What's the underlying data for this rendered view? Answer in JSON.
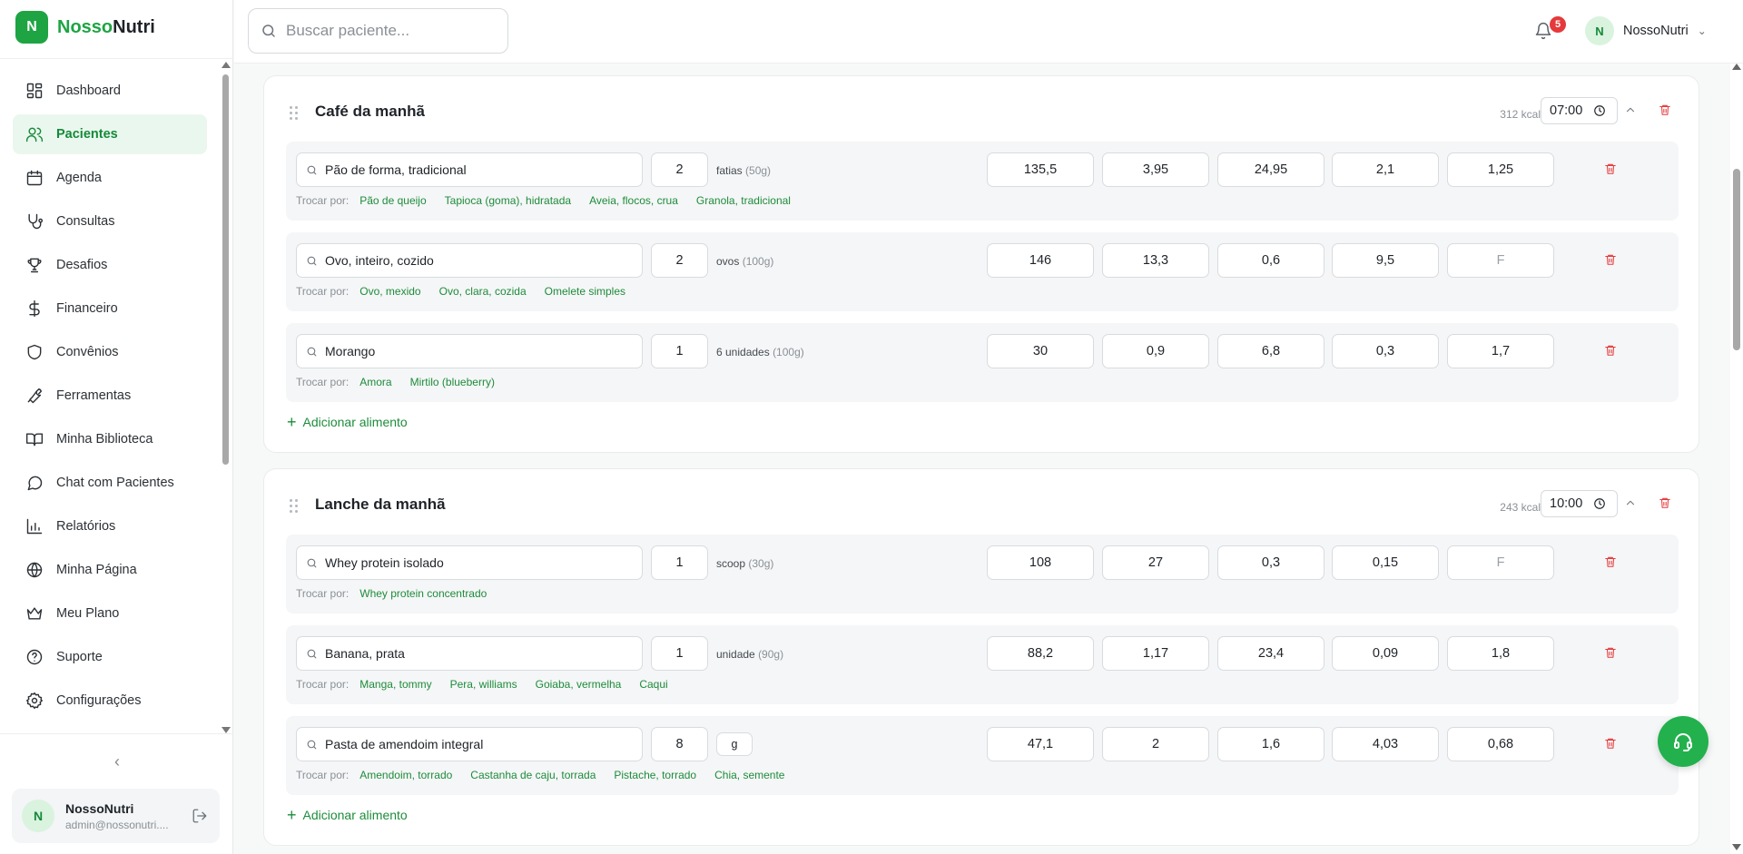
{
  "brand": {
    "logo_letter": "N",
    "name_part1": "Nosso",
    "name_part2": "Nutri",
    "color": "#1ea443"
  },
  "sidebar": {
    "items": [
      {
        "label": "Dashboard",
        "icon": "layout-grid-icon",
        "active": false
      },
      {
        "label": "Pacientes",
        "icon": "users-icon",
        "active": true
      },
      {
        "label": "Agenda",
        "icon": "calendar-icon",
        "active": false
      },
      {
        "label": "Consultas",
        "icon": "stethoscope-icon",
        "active": false
      },
      {
        "label": "Desafios",
        "icon": "trophy-icon",
        "active": false
      },
      {
        "label": "Financeiro",
        "icon": "dollar-icon",
        "active": false
      },
      {
        "label": "Convênios",
        "icon": "shield-icon",
        "active": false
      },
      {
        "label": "Ferramentas",
        "icon": "wrench-icon",
        "active": false
      },
      {
        "label": "Minha Biblioteca",
        "icon": "book-icon",
        "active": false
      },
      {
        "label": "Chat com Pacientes",
        "icon": "chat-icon",
        "active": false
      },
      {
        "label": "Relatórios",
        "icon": "bar-chart-icon",
        "active": false
      },
      {
        "label": "Minha Página",
        "icon": "globe-icon",
        "active": false
      },
      {
        "label": "Meu Plano",
        "icon": "crown-icon",
        "active": false
      },
      {
        "label": "Suporte",
        "icon": "help-circle-icon",
        "active": false
      },
      {
        "label": "Configurações",
        "icon": "settings-icon",
        "active": false
      }
    ],
    "user": {
      "initial": "N",
      "name": "NossoNutri",
      "email": "admin@nossonutri...."
    }
  },
  "header": {
    "search_placeholder": "Buscar paciente...",
    "notification_count": "5",
    "user_initial": "N",
    "user_name": "NossoNutri"
  },
  "meals": [
    {
      "title": "Café da manhã",
      "kcal": "312 kcal",
      "time": "07:00",
      "items": [
        {
          "food": "Pão de forma, tradicional",
          "qty": "2",
          "unit": "fatias",
          "unit_grams": "(50g)",
          "nutrients": [
            "135,5",
            "3,95",
            "24,95",
            "2,1",
            "1,25"
          ],
          "swaps_label": "Trocar por:",
          "swaps": [
            "Pão de queijo",
            "Tapioca (goma), hidratada",
            "Aveia, flocos, crua",
            "Granola, tradicional"
          ]
        },
        {
          "food": "Ovo, inteiro, cozido",
          "qty": "2",
          "unit": "ovos",
          "unit_grams": "(100g)",
          "nutrients": [
            "146",
            "13,3",
            "0,6",
            "9,5",
            "F"
          ],
          "swaps_label": "Trocar por:",
          "swaps": [
            "Ovo, mexido",
            "Ovo, clara, cozida",
            "Omelete simples"
          ]
        },
        {
          "food": "Morango",
          "qty": "1",
          "unit": "6 unidades",
          "unit_grams": "(100g)",
          "nutrients": [
            "30",
            "0,9",
            "6,8",
            "0,3",
            "1,7"
          ],
          "swaps_label": "Trocar por:",
          "swaps": [
            "Amora",
            "Mirtilo (blueberry)"
          ]
        }
      ],
      "add_label": "Adicionar alimento"
    },
    {
      "title": "Lanche da manhã",
      "kcal": "243 kcal",
      "time": "10:00",
      "items": [
        {
          "food": "Whey protein isolado",
          "qty": "1",
          "unit": "scoop",
          "unit_grams": "(30g)",
          "nutrients": [
            "108",
            "27",
            "0,3",
            "0,15",
            "F"
          ],
          "swaps_label": "Trocar por:",
          "swaps": [
            "Whey protein concentrado"
          ]
        },
        {
          "food": "Banana, prata",
          "qty": "1",
          "unit": "unidade",
          "unit_grams": "(90g)",
          "nutrients": [
            "88,2",
            "1,17",
            "23,4",
            "0,09",
            "1,8"
          ],
          "swaps_label": "Trocar por:",
          "swaps": [
            "Manga, tommy",
            "Pera, williams",
            "Goiaba, vermelha",
            "Caqui"
          ]
        },
        {
          "food": "Pasta de amendoim integral",
          "qty": "8",
          "unit_box": "g",
          "nutrients": [
            "47,1",
            "2",
            "1,6",
            "4,03",
            "0,68"
          ],
          "swaps_label": "Trocar por:",
          "swaps": [
            "Amendoim, torrado",
            "Castanha de caju, torrada",
            "Pistache, torrado",
            "Chia, semente"
          ]
        }
      ],
      "add_label": "Adicionar alimento"
    }
  ]
}
